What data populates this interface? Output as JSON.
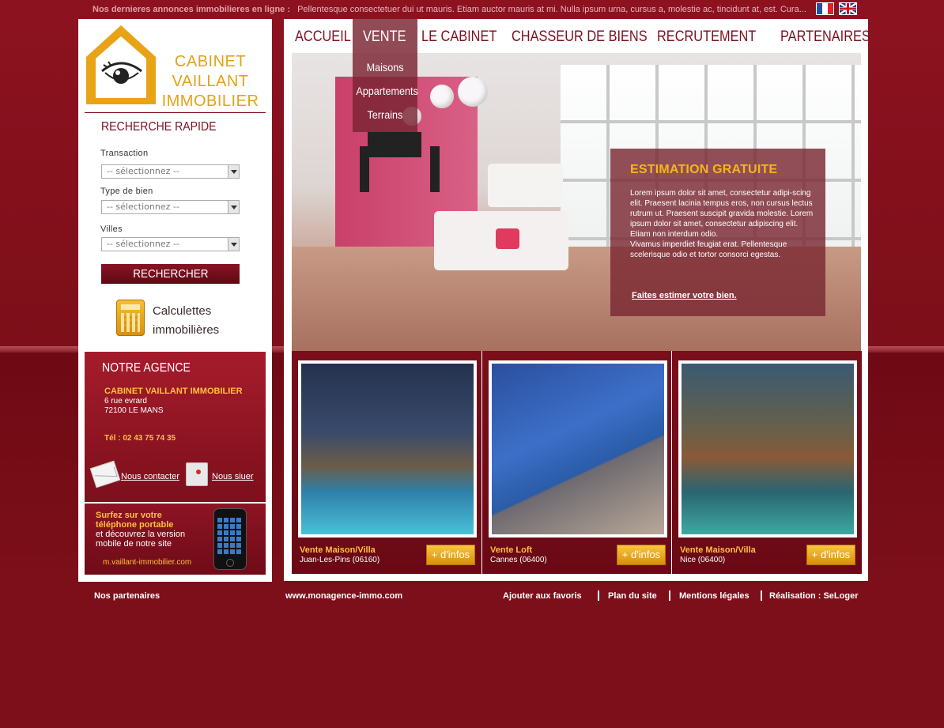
{
  "ticker": {
    "label": "Nos dernieres annonces immobilieres en ligne :",
    "text": "Pellentesque consectetuer dui ut mauris. Etiam auctor mauris at mi. Nulla ipsum urna, cursus a, molestie ac, tincidunt at, est. Cura..."
  },
  "languages": [
    "fr",
    "en"
  ],
  "logo": {
    "line1": "CABINET",
    "line2": "VAILLANT",
    "line3": "IMMOBILIER"
  },
  "search": {
    "title": "RECHERCHE RAPIDE",
    "transaction_label": "Transaction",
    "transaction_value": "-- sélectionnez --",
    "type_label": "Type de bien",
    "type_value": "-- sélectionnez --",
    "city_label": "Villes",
    "city_value": "-- sélectionnez --",
    "button": "RECHERCHER"
  },
  "calc": {
    "line1": "Calculettes",
    "line2": "immobilières"
  },
  "agency": {
    "title": "NOTRE AGENCE",
    "name": "CABINET VAILLANT IMMOBILIER",
    "address1": "6 rue evrard",
    "address2": "72100 LE MANS",
    "tel": "Tél : 02 43 75 74 35",
    "contact": "Nous contacter",
    "locate": "Nous siuer"
  },
  "mobile": {
    "line1": "Surfez sur votre",
    "line2": "téléphone portable",
    "line3": "et découvrez la version",
    "line4": "mobile de notre site",
    "url": "m.vaillant-immobilier.com"
  },
  "nav": {
    "items": [
      "ACCUEIL",
      "VENTE",
      "LE CABINET",
      "CHASSEUR DE BIENS",
      "RECRUTEMENT",
      "PARTENAIRES"
    ],
    "active": "VENTE",
    "submenu": [
      "Maisons",
      "Appartements",
      "Terrains"
    ]
  },
  "estimation": {
    "title": "ESTIMATION GRATUITE",
    "body": "Lorem ipsum dolor sit amet, consectetur adipi-scing elit. Praesent lacinia tempus eros, non cursus lectus rutrum ut. Praesent suscipit gravida molestie. Lorem ipsum dolor sit amet, consectetur adipiscing elit. Etiam non interdum odio.",
    "body2": "Vivamus imperdiet feugiat erat. Pellentesque scelerisque odio et tortor consorci egestas.",
    "link": "Faites estimer votre bien."
  },
  "listings": [
    {
      "title": "Vente Maison/Villa",
      "location": "Juan-Les-Pins (06160)",
      "button": "+ d'infos"
    },
    {
      "title": "Vente Loft",
      "location": "Cannes (06400)",
      "button": "+ d'infos"
    },
    {
      "title": "Vente Maison/Villa",
      "location": "Nice (06400)",
      "button": "+ d'infos"
    }
  ],
  "footer": {
    "partners": "Nos partenaires",
    "site": "www.monagence-immo.com",
    "links": [
      "Ajouter aux favoris",
      "Plan du site",
      "Mentions légales",
      "Réalisation : SeLoger"
    ]
  },
  "colors": {
    "background": "#7c0f19",
    "brand_red": "#7d1020",
    "accent_gold": "#ffc13b",
    "logo_orange": "#e2a21a"
  }
}
